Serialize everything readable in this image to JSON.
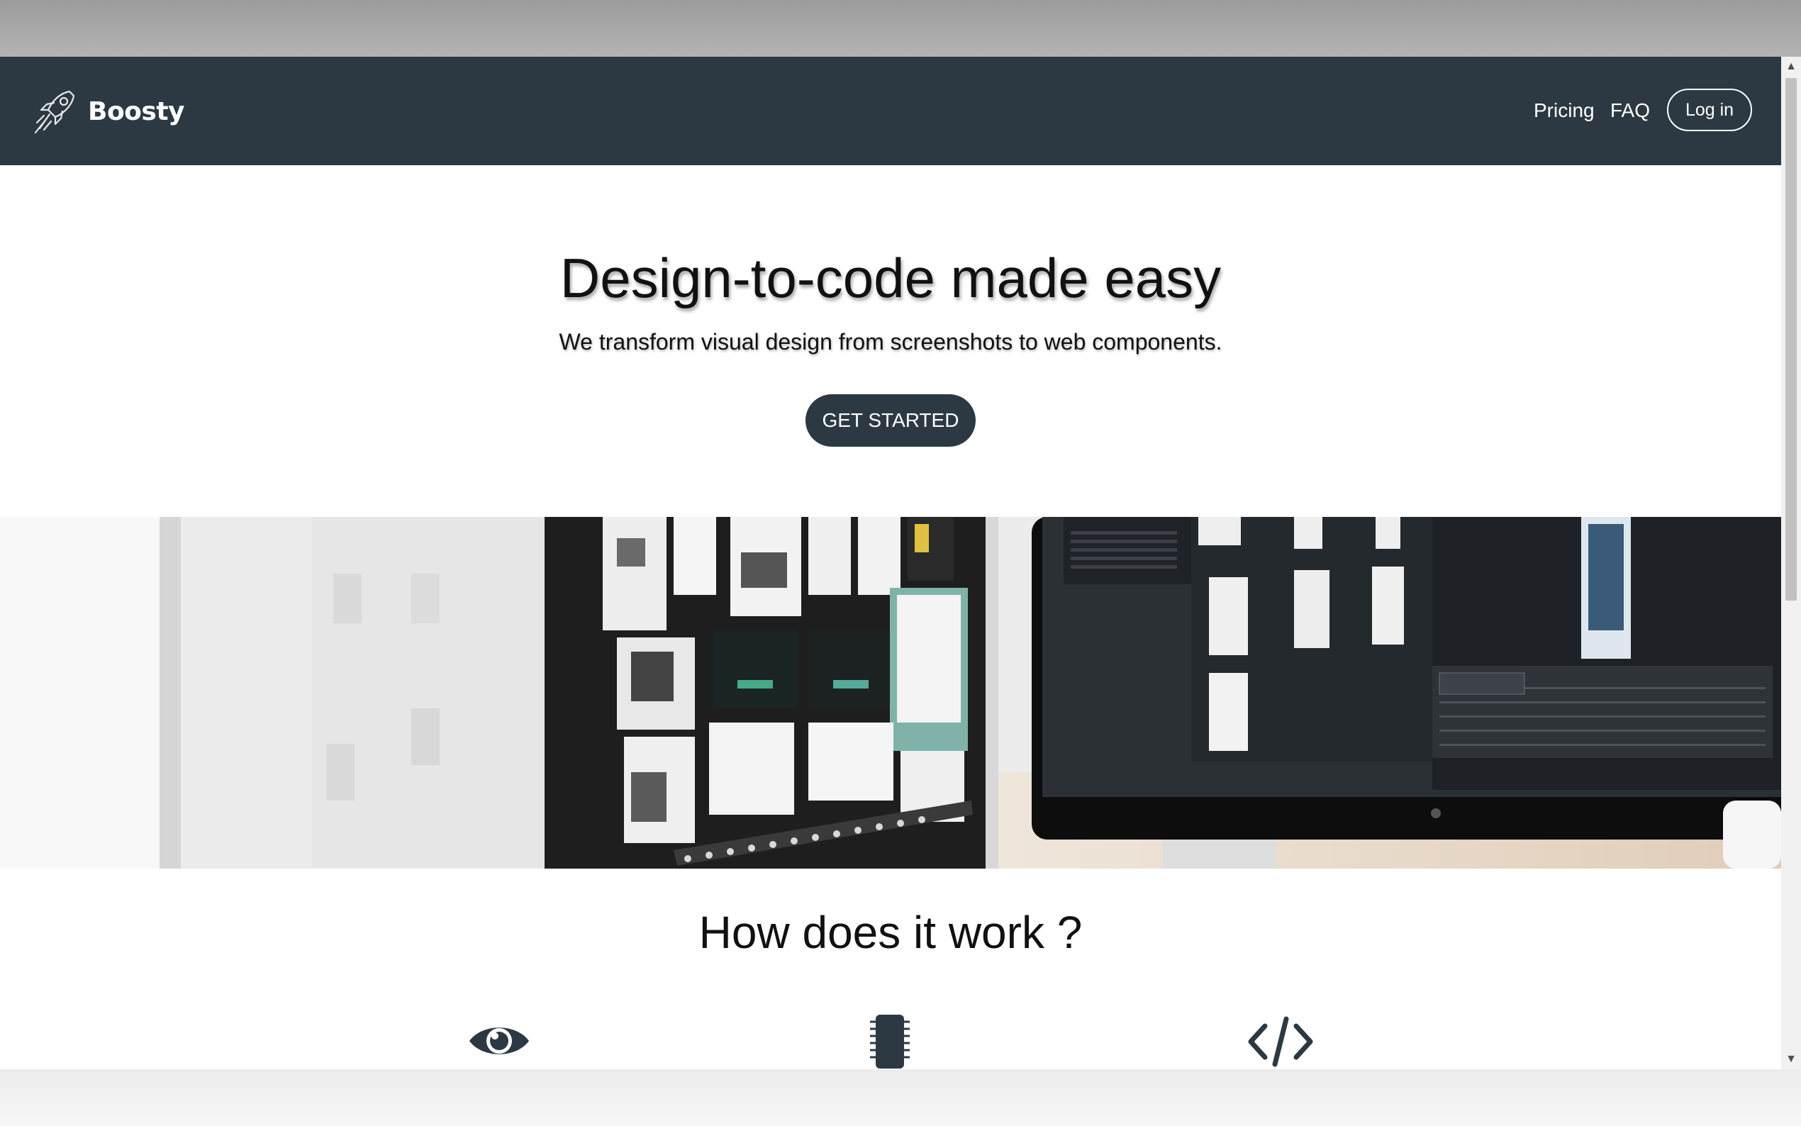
{
  "brand": {
    "name": "Boosty",
    "logo_icon": "rocket-icon"
  },
  "nav": {
    "links": [
      {
        "label": "Pricing"
      },
      {
        "label": "FAQ"
      }
    ],
    "login_label": "Log in"
  },
  "hero": {
    "title": "Design-to-code made easy",
    "subtitle": "We transform visual design from screenshots to web components.",
    "cta_label": "GET STARTED"
  },
  "banner": {
    "image_subject": "two desktop monitors displaying design mockups"
  },
  "how": {
    "title": "How does it work ?",
    "steps": [
      {
        "icon": "eye-icon"
      },
      {
        "icon": "chip-icon"
      },
      {
        "icon": "code-icon"
      }
    ]
  },
  "colors": {
    "nav_bg": "#2c3942",
    "cta_bg": "#2c3942",
    "text": "#111111",
    "page_bg": "#ffffff"
  }
}
